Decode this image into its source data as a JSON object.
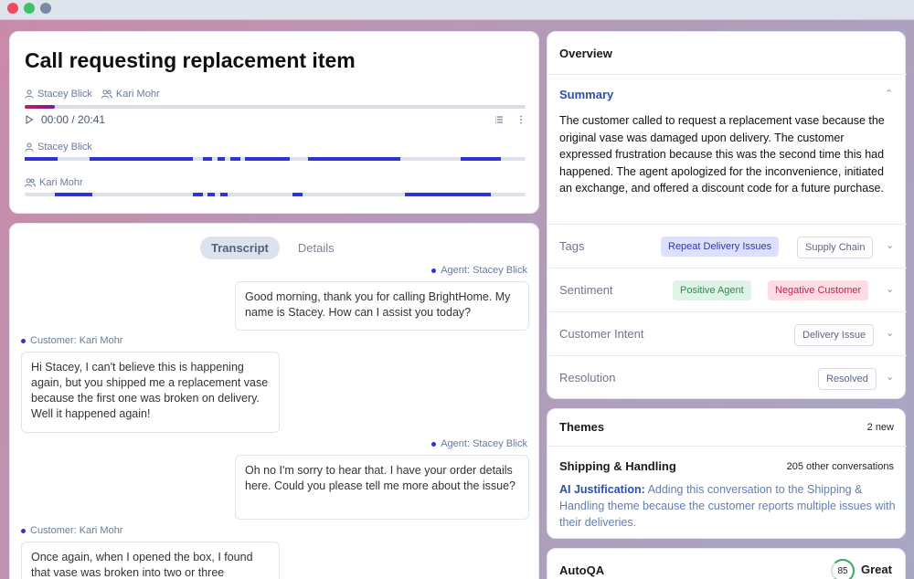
{
  "window": {
    "controls": [
      "close",
      "maximize",
      "minimize"
    ]
  },
  "call": {
    "title": "Call requesting replacement item",
    "agent": "Stacey Blick",
    "customer": "Kari Mohr",
    "time": "00:00 / 20:41",
    "progress_fraction": 0.06
  },
  "tracks": [
    {
      "name": "Stacey Blick",
      "segments": [
        [
          0,
          0.065
        ],
        [
          0.13,
          0.335
        ],
        [
          0.355,
          0.375
        ],
        [
          0.385,
          0.4
        ],
        [
          0.41,
          0.43
        ],
        [
          0.44,
          0.53
        ],
        [
          0.565,
          0.75
        ],
        [
          0.87,
          0.95
        ]
      ]
    },
    {
      "name": "Kari Mohr",
      "segments": [
        [
          0.06,
          0.135
        ],
        [
          0.335,
          0.355
        ],
        [
          0.365,
          0.38
        ],
        [
          0.39,
          0.405
        ],
        [
          0.535,
          0.555
        ],
        [
          0.76,
          0.93
        ]
      ]
    }
  ],
  "transcript_tabs": [
    {
      "label": "Transcript",
      "active": true
    },
    {
      "label": "Details",
      "active": false
    }
  ],
  "messages": [
    {
      "speaker": "Agent: Stacey Blick",
      "side": "right",
      "text": "Good morning, thank you for calling BrightHome. My name is Stacey. How can I assist you today?"
    },
    {
      "speaker": "Customer: Kari Mohr",
      "side": "left",
      "text": "Hi Stacey, I can't believe this is happening again, but you shipped me a replacement vase because the first one was broken on delivery. Well it happened again!"
    },
    {
      "speaker": "Agent: Stacey Blick",
      "side": "right",
      "text": "Oh no I'm sorry to hear that. I have your order details here. Could you please tell me more about the issue?"
    },
    {
      "speaker": "Customer: Kari Mohr",
      "side": "left",
      "text": "Once again, when I opened the box, I found that vase was broken into two or three"
    }
  ],
  "overview": {
    "title": "Overview",
    "summary_label": "Summary",
    "summary_text": "The customer called to request a replacement vase because the original vase was damaged upon delivery.  The customer expressed frustration because this was the second time this had happened. The agent apologized for the inconvenience, initiated an exchange, and offered a discount code for a future purchase.",
    "tags_label": "Tags",
    "tags": [
      "Repeat Delivery Issues",
      "Supply Chain"
    ],
    "sentiment_label": "Sentiment",
    "sentiment": [
      "Positive Agent",
      "Negative Customer"
    ],
    "intent_label": "Customer Intent",
    "intent": "Delivery Issue",
    "resolution_label": "Resolution",
    "resolution": "Resolved"
  },
  "themes": {
    "title": "Themes",
    "new_count": "2 new",
    "theme_name": "Shipping & Handling",
    "theme_count": "205 other conversations",
    "justification_label": "AI Justification:",
    "justification_text": "Adding this conversation to the Shipping & Handling theme because the customer reports multiple issues with their deliveries."
  },
  "autoqa": {
    "title": "AutoQA",
    "score": "85",
    "rating": "Great"
  },
  "colors": {
    "accent": "#2f33d6",
    "link": "#2a4fb3",
    "positive": "#2f8b52",
    "negative": "#c02451"
  }
}
